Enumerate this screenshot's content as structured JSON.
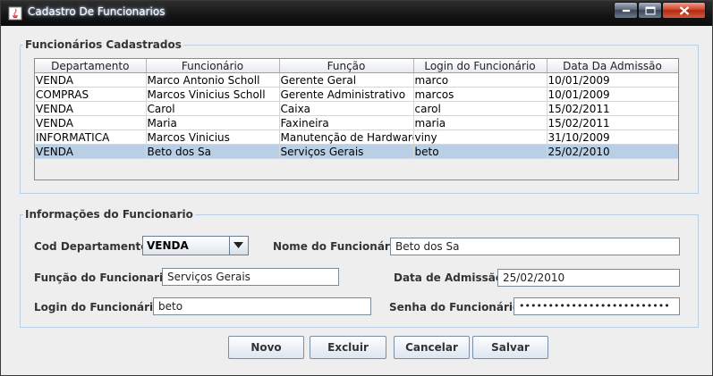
{
  "window": {
    "title": "Cadastro De Funcionarios"
  },
  "table_group": {
    "legend": "Funcionários Cadastrados",
    "columns": [
      "Departamento",
      "Funcionário",
      "Função",
      "Login do Funcionário",
      "Data Da Admissão"
    ],
    "rows": [
      [
        "VENDA",
        "Marco Antonio Scholl",
        "Gerente Geral",
        "marco",
        "10/01/2009"
      ],
      [
        "COMPRAS",
        "Marcos Vinicius Scholl",
        "Gerente Administrativo",
        "marcos",
        "10/01/2009"
      ],
      [
        "VENDA",
        "Carol",
        "Caixa",
        "carol",
        "15/02/2011"
      ],
      [
        "VENDA",
        "Maria",
        "Faxineira",
        "maria",
        "15/02/2011"
      ],
      [
        "INFORMATICA",
        "Marcos Vinicius",
        "Manutenção de Hardware",
        "viny",
        "31/10/2009"
      ],
      [
        "VENDA",
        "Beto dos Sa",
        "Serviços Gerais",
        "beto",
        "25/02/2010"
      ]
    ],
    "selected_row": 5
  },
  "form": {
    "legend": "Informações do Funcionario",
    "cod_departamento": {
      "label": "Cod Departamento:",
      "value": "VENDA"
    },
    "nome": {
      "label": "Nome do Funcionário:",
      "value": "Beto dos Sa"
    },
    "funcao": {
      "label": "Função do Funcionario:",
      "value": "Serviços Gerais"
    },
    "data_admissao": {
      "label": "Data de Admissão:",
      "value": "25/02/2010"
    },
    "login": {
      "label": "Login do Funcionário:",
      "value": "beto"
    },
    "senha": {
      "label": "Senha do Funcionário:",
      "value": "••••••••••••••••••••••••••"
    }
  },
  "buttons": {
    "novo": "Novo",
    "excluir": "Excluir",
    "cancelar": "Cancelar",
    "salvar": "Salvar"
  },
  "colors": {
    "selection": "#b8cfe5",
    "titlebar": "#141414",
    "close_button": "#d2452c",
    "group_border": "#b8cfe5"
  }
}
